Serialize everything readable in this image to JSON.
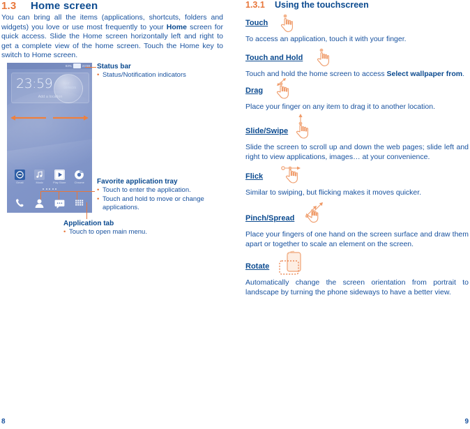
{
  "left_page": {
    "section": {
      "number": "1.3",
      "title": "Home screen"
    },
    "intro_paragraph": "You can bring all the items (applications, shortcuts, folders and widgets) you love or use most frequently to your Home screen for quick access. Slide the Home screen horizontally left and right to get a complete view of the home screen. Touch the Home key to switch to Home screen.",
    "intro_bold_word": "Home",
    "phone": {
      "status_bar": {
        "battery_percent": "83%",
        "clock": "23:59"
      },
      "clock_widget": {
        "time": "23:59",
        "day_line1": "SAT",
        "day_line2": "09/06/25",
        "location_hint": "Add a location"
      },
      "apps": [
        {
          "label": "Gmail",
          "icon": "gmail-icon"
        },
        {
          "label": "Music",
          "icon": "music-icon"
        },
        {
          "label": "Play Store",
          "icon": "play-store-icon"
        },
        {
          "label": "Chrome",
          "icon": "chrome-icon"
        }
      ],
      "page_dots": 5,
      "dock": [
        {
          "label": "Phone",
          "icon": "phone-icon"
        },
        {
          "label": "Contacts",
          "icon": "contacts-icon"
        },
        {
          "label": "Messaging",
          "icon": "messaging-icon"
        },
        {
          "label": "Application tab",
          "icon": "app-drawer-icon"
        }
      ]
    },
    "callouts": {
      "status_bar": {
        "title": "Status bar",
        "bullets": [
          "Status/Notification indicators"
        ]
      },
      "favorite_tray": {
        "title": "Favorite application tray",
        "bullets": [
          "Touch to enter the application.",
          "Touch and hold to move or change"
        ],
        "continuation": "applications."
      },
      "application_tab": {
        "title": "Application tab",
        "bullets": [
          "Touch to open main menu."
        ]
      }
    },
    "page_number": "8"
  },
  "right_page": {
    "section": {
      "number": "1.3.1",
      "title": "Using the touchscreen"
    },
    "gestures": [
      {
        "label": "Touch",
        "icon": "touch-hand-icon",
        "description": "To access an application, touch it with your finger."
      },
      {
        "label": "Touch and Hold",
        "icon": "touch-hold-hand-icon",
        "description": "Touch and hold the home screen to access Select wallpaper from.",
        "description_bold": "Select wallpaper from"
      },
      {
        "label": "Drag",
        "icon": "drag-hand-icon",
        "description": "Place your finger on any item to drag it to another location."
      },
      {
        "label": "Slide/Swipe",
        "icon": "slide-hand-icon",
        "description": "Slide the screen to scroll up and down the web pages; slide left and right to view applications, images… at your convenience."
      },
      {
        "label": "Flick",
        "icon": "flick-hand-icon",
        "description": "Similar to swiping, but flicking makes it moves quicker."
      },
      {
        "label": "Pinch/Spread",
        "icon": "pinch-spread-hand-icon",
        "description": "Place your fingers of one hand on the screen surface and draw them apart or together to scale an element on the screen."
      },
      {
        "label": "Rotate",
        "icon": "rotate-device-icon",
        "description": "Automatically change the screen orientation from portrait to landscape by turning the phone sideways to have a better view."
      }
    ],
    "page_number": "9"
  },
  "colors": {
    "heading_blue": "#0b4a8f",
    "body_blue": "#17519e",
    "accent_orange": "#e8763a",
    "phone_screen": "#8296c9"
  }
}
